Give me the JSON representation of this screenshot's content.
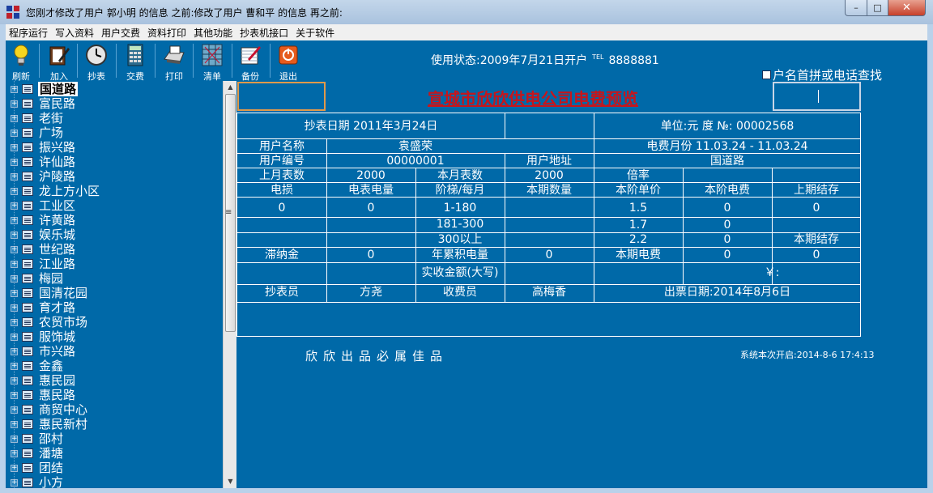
{
  "window": {
    "title": "您刚才修改了用户 郭小明 的信息 之前:修改了用户 曹和平 的信息 再之前:",
    "min": "–",
    "max": "□",
    "close": "✕"
  },
  "menu": [
    "程序运行",
    "写入资料",
    "用户交费",
    "资料打印",
    "其他功能",
    "抄表机接口",
    "关于软件"
  ],
  "toolbar": {
    "refresh": "刷新",
    "add": "加入",
    "read": "抄表",
    "pay": "交费",
    "print": "打印",
    "list": "清单",
    "backup": "备份",
    "exit": "退出"
  },
  "status": {
    "usage": "使用状态:2009年7月21日开户",
    "tel_label": "TEL",
    "tel": "8888881"
  },
  "lookup_label": "户名首拼或电话查找",
  "tree": {
    "expander": "+",
    "items": [
      "国道路",
      "富民路",
      "老街",
      "广场",
      "振兴路",
      "许仙路",
      "沪陵路",
      "龙上方小区",
      "工业区",
      "许黄路",
      "娱乐城",
      "世纪路",
      "江业路",
      "梅园",
      "国清花园",
      "育才路",
      "农贸市场",
      "服饰城",
      "市兴路",
      "金鑫",
      "惠民园",
      "惠民路",
      "商贸中心",
      "惠民新村",
      "邵村",
      "潘塘",
      "团结",
      "小方"
    ]
  },
  "bill": {
    "title": "宣城市欣欣供电公司电费预览",
    "read_date": "抄表日期 2011年3月24日",
    "unit": "单位:元 度  №: 00002568",
    "user_name_label": "用户名称",
    "user_name": "袁盛荣",
    "period_label": "电费月份",
    "period": "11.03.24 - 11.03.24",
    "user_no_label": "用户编号",
    "user_no": "00000001",
    "address_label": "用户地址",
    "address": "国道路",
    "last_reading_label": "上月表数",
    "last_reading": "2000",
    "this_reading_label": "本月表数",
    "this_reading": "2000",
    "multiplier_label": "倍率",
    "h_loss": "电损",
    "h_meter": "电表电量",
    "h_tier": "阶梯/每月",
    "h_qty": "本期数量",
    "h_price": "本阶单价",
    "h_fee": "本阶电费",
    "h_prev": "上期结存",
    "r1": [
      "0",
      "0",
      "1-180",
      "",
      "1.5",
      "0",
      "0"
    ],
    "r2": [
      "",
      "",
      "181-300",
      "",
      "1.7",
      "0",
      ""
    ],
    "r3": [
      "",
      "",
      "300以上",
      "",
      "2.2",
      "0",
      "本期结存"
    ],
    "late_fee_label": "滞纳金",
    "late_fee": "0",
    "annual_label": "年累积电量",
    "annual": "0",
    "this_fee_label": "本期电费",
    "this_fee": "0",
    "balance": "0",
    "total_label": "实收金额(大写)",
    "yen": "￥:",
    "reader_label": "抄表员",
    "reader": "方尧",
    "cashier_label": "收费员",
    "cashier": "高梅香",
    "issue_date": "出票日期:2014年8月6日"
  },
  "slogan": "欣欣出品必属佳品",
  "system_open": "系统本次开启:2014-8-6 17:4:13"
}
